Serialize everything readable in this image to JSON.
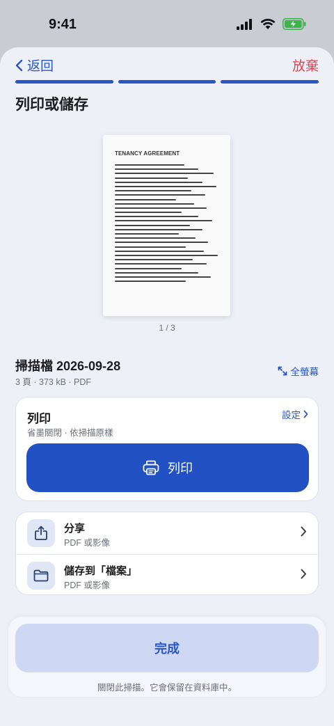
{
  "status_bar": {
    "time": "9:41"
  },
  "nav": {
    "back_label": "返回",
    "discard_label": "放棄"
  },
  "progress": {
    "steps_total": 3,
    "steps_completed": 3
  },
  "page_title": "列印或儲存",
  "preview": {
    "doc_title": "TENANCY AGREEMENT",
    "page_indicator": "1 / 3"
  },
  "file": {
    "name": "掃描檔 2026-09-28",
    "meta": "3 頁 · 373 kB · PDF",
    "fullscreen_label": "全螢幕"
  },
  "print_card": {
    "title": "列印",
    "subtitle": "省墨關閉 · 依掃描原樣",
    "settings_label": "設定",
    "print_button_label": "列印"
  },
  "actions": [
    {
      "title": "分享",
      "subtitle": "PDF 或影像",
      "icon": "share-icon"
    },
    {
      "title": "儲存到「檔案」",
      "subtitle": "PDF 或影像",
      "icon": "folder-icon"
    }
  ],
  "bottom": {
    "done_label": "完成",
    "note": "關閉此掃描。它會保留在資料庫中。"
  },
  "colors": {
    "accent": "#2251c3",
    "destructive": "#e0464b",
    "background": "#eef0f8"
  }
}
